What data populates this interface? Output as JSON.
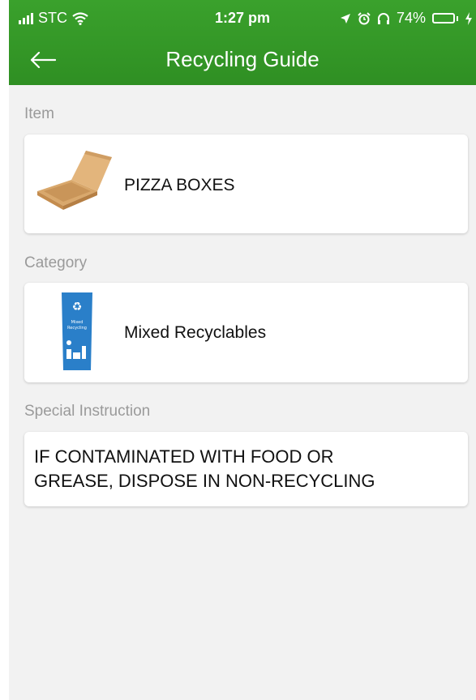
{
  "status_bar": {
    "carrier": "STC",
    "time": "1:27 pm",
    "battery_percent": "74%",
    "battery_level": 0.74,
    "icons": [
      "signal-icon",
      "wifi-icon",
      "location-icon",
      "alarm-icon",
      "headphones-icon",
      "battery-icon",
      "charging-icon"
    ]
  },
  "header": {
    "title": "Recycling Guide",
    "back_icon": "back-arrow-icon",
    "color": "#33992a"
  },
  "item": {
    "label": "Item",
    "name": "PIZZA BOXES",
    "image_icon": "pizza-box-icon"
  },
  "category": {
    "label": "Category",
    "name": "Mixed Recyclables",
    "image_icon": "recycling-bin-icon",
    "bin_text": "Mixed Recycling",
    "bin_color": "#2a7fc9"
  },
  "special_instruction": {
    "label": "Special Instruction",
    "lines": [
      "IF CONTAMINATED WITH FOOD OR",
      "GREASE, DISPOSE IN NON-RECYCLING"
    ]
  }
}
